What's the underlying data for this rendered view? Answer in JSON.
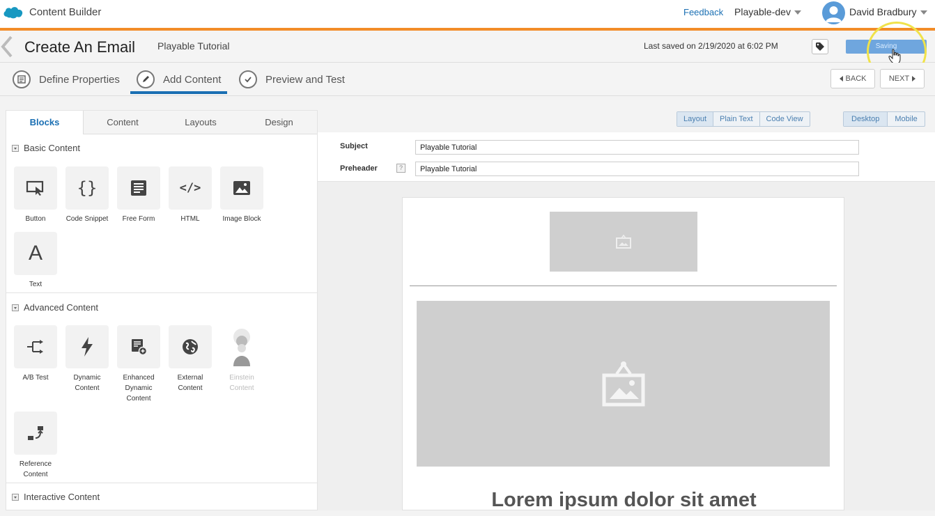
{
  "header": {
    "app_title": "Content Builder",
    "feedback": "Feedback",
    "org": "Playable-dev",
    "user": "David Bradbury",
    "accent_color": "#f28c28"
  },
  "title_bar": {
    "title": "Create An Email",
    "subtitle": "Playable Tutorial",
    "last_saved": "Last saved on 2/19/2020 at 6:02 PM",
    "save_button": "Saving"
  },
  "steps": [
    {
      "label": "Define Properties",
      "icon": "properties-icon"
    },
    {
      "label": "Add Content",
      "icon": "pencil-icon",
      "active": true
    },
    {
      "label": "Preview and Test",
      "icon": "check-icon"
    }
  ],
  "nav": {
    "back": "BACK",
    "next": "NEXT"
  },
  "left_panel": {
    "tabs": [
      "Blocks",
      "Content",
      "Layouts",
      "Design"
    ],
    "active_tab": "Blocks",
    "sections": {
      "basic": {
        "title": "Basic Content",
        "blocks": [
          "Button",
          "Code Snippet",
          "Free Form",
          "HTML",
          "Image Block",
          "Text"
        ]
      },
      "advanced": {
        "title": "Advanced Content",
        "blocks": [
          "A/B Test",
          "Dynamic Content",
          "Enhanced Dynamic Content",
          "External Content",
          "Einstein Content",
          "Reference Content"
        ]
      },
      "interactive": {
        "title": "Interactive Content"
      }
    }
  },
  "view_toggles": {
    "modes": [
      "Layout",
      "Plain Text",
      "Code View"
    ],
    "devices": [
      "Desktop",
      "Mobile"
    ]
  },
  "fields": {
    "subject_label": "Subject",
    "subject_value": "Playable Tutorial",
    "preheader_label": "Preheader",
    "preheader_help": "?",
    "preheader_value": "Playable Tutorial"
  },
  "canvas": {
    "heading": "Lorem ipsum dolor sit amet"
  }
}
